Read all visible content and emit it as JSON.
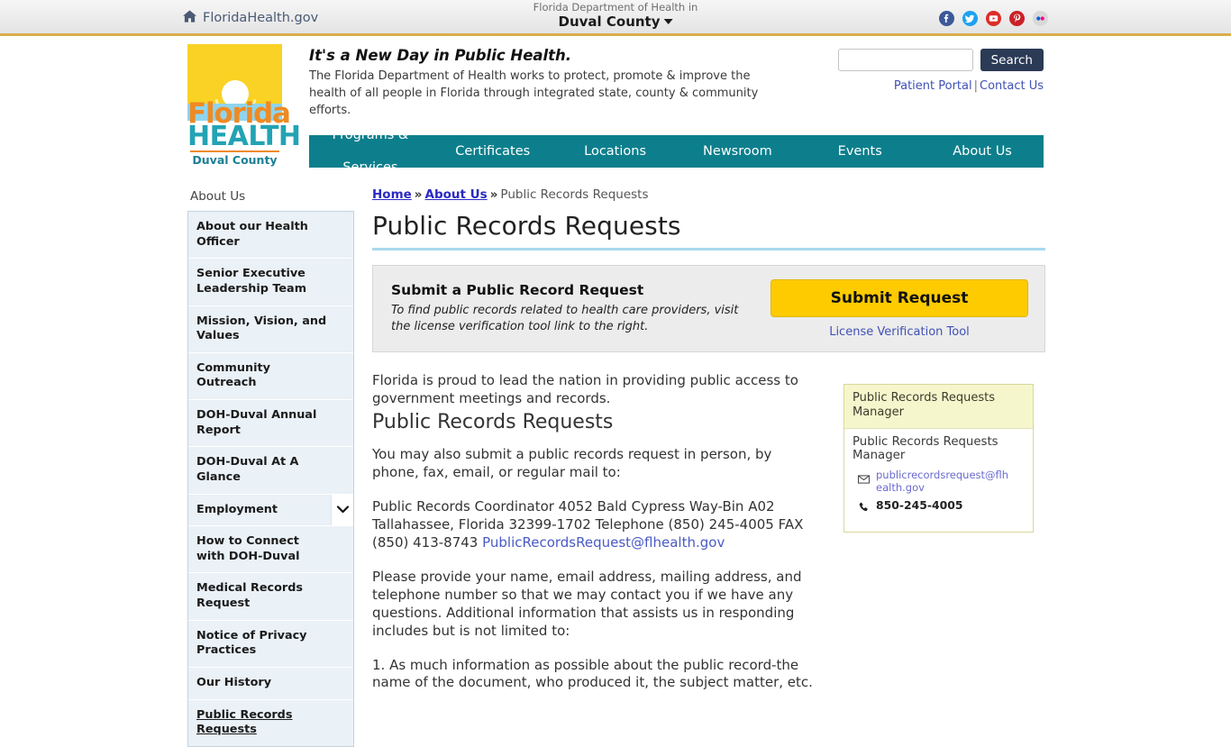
{
  "topbar": {
    "home_icon": "home-icon",
    "gov_link": "FloridaHealth.gov",
    "dept_prefix": "Florida Department of Health in",
    "county": "Duval County",
    "socials": [
      {
        "name": "facebook-icon",
        "color": "#3b5998"
      },
      {
        "name": "twitter-icon",
        "color": "#1da1f2"
      },
      {
        "name": "youtube-icon",
        "color": "#dd2c28"
      },
      {
        "name": "pinterest-icon",
        "color": "#cb2027"
      },
      {
        "name": "flickr-icon",
        "color": "#d6d6d6"
      }
    ]
  },
  "masthead": {
    "logo": {
      "florida": "Florida",
      "health": "HEALTH",
      "county": "Duval County"
    },
    "tagline_title": "It's a New Day in Public Health.",
    "tagline_body": "The Florida Department of Health works to protect, promote & improve the health of all people in Florida through integrated state, county & community efforts.",
    "search": {
      "value": "",
      "placeholder": "",
      "button_label": "Search"
    },
    "patient_portal": "Patient Portal",
    "separator": "|",
    "contact_us": "Contact Us"
  },
  "mainnav": [
    {
      "label": "Programs & Services"
    },
    {
      "label": "Certificates"
    },
    {
      "label": "Locations"
    },
    {
      "label": "Newsroom"
    },
    {
      "label": "Events"
    },
    {
      "label": "About Us"
    }
  ],
  "sidebar": {
    "title": "About Us",
    "items": [
      {
        "label": "About our Health Officer",
        "active": false,
        "submenu": false
      },
      {
        "label": "Senior Executive Leadership Team",
        "active": false,
        "submenu": false
      },
      {
        "label": "Mission, Vision, and Values",
        "active": false,
        "submenu": false
      },
      {
        "label": "Community Outreach",
        "active": false,
        "submenu": false
      },
      {
        "label": "DOH-Duval Annual Report",
        "active": false,
        "submenu": false
      },
      {
        "label": "DOH-Duval At A Glance",
        "active": false,
        "submenu": false
      },
      {
        "label": "Employment",
        "active": false,
        "submenu": true
      },
      {
        "label": "How to Connect with DOH-Duval",
        "active": false,
        "submenu": false
      },
      {
        "label": "Medical Records Request",
        "active": false,
        "submenu": false
      },
      {
        "label": "Notice of Privacy Practices",
        "active": false,
        "submenu": false
      },
      {
        "label": "Our History",
        "active": false,
        "submenu": false
      },
      {
        "label": "Public Records Requests",
        "active": true,
        "submenu": false
      }
    ],
    "chevron_icon": "chevron-down-icon"
  },
  "breadcrumb": {
    "home": "Home",
    "sep": "»",
    "about": "About Us",
    "current": "Public Records Requests"
  },
  "main": {
    "page_title": "Public Records Requests",
    "callout": {
      "heading": "Submit a Public Record Request",
      "body": "To find public records related to health care providers, visit the license verification tool link to the right.",
      "button_label": "Submit Request",
      "link_label": "License Verification Tool"
    },
    "intro": "Florida is proud to lead the nation in providing public access to government meetings and records.",
    "section_heading": "Public Records Requests",
    "para_submit": "You may also submit a public records request in person, by phone, fax, email, or regular mail to:",
    "address_text": "Public Records Coordinator 4052 Bald Cypress Way-Bin A02 Tallahassee, Florida 32399-1702 Telephone (850) 245-4005 FAX (850) 413-8743 ",
    "address_email": "PublicRecordsRequest@flhealth.gov",
    "para_provide": "Please provide your name, email address, mailing address, and telephone number so that we may contact you if we have any questions. Additional information that assists us in responding includes but is not limited to:",
    "list_item_1": "1. As much information as possible about the public record-the name of the document, who produced it, the subject matter, etc."
  },
  "contact_card": {
    "header": "Public Records Requests Manager",
    "name": "Public Records Requests Manager",
    "email_icon": "envelope-icon",
    "email": "publicrecordsrequest@flhealth.gov",
    "phone_icon": "phone-icon",
    "phone": "850-245-4005"
  },
  "colors": {
    "teal_nav": "#0d7f8c",
    "gold_rule": "#d9ad4b",
    "yellow_button": "#fecb00",
    "title_underline": "#a9d9ec",
    "card_header": "#f6f6cd",
    "link_blue": "#3f51b5"
  }
}
